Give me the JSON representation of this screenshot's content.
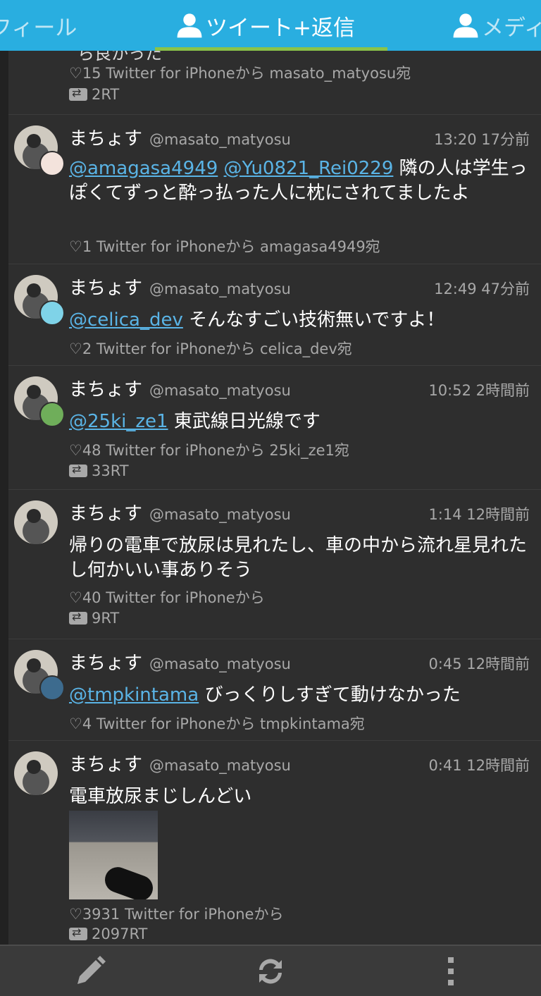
{
  "tabs": [
    {
      "label": "フィール",
      "icon": "user-icon"
    },
    {
      "label": "ツイート+返信",
      "icon": "user-icon",
      "active": true
    },
    {
      "label": "メディ",
      "icon": "user-icon"
    }
  ],
  "colors": {
    "accent": "#29aee0",
    "indicator": "#8bc34a",
    "mention": "#5ab4e6",
    "background": "#2e2e2e"
  },
  "partial_tweet": {
    "cut_text": "ら良かった",
    "meta": "♡15 Twitter for iPhoneから masato_matyosu宛",
    "rt": "2RT"
  },
  "tweets": [
    {
      "name": "まちょす",
      "handle": "@masato_matyosu",
      "time": "13:20 17分前",
      "mentions": [
        "@amagasa4949",
        "@Yu0821_Rei0229"
      ],
      "text": "隣の人は学生っぽくてずっと酔っ払った人に枕にされてましたよ",
      "meta": "♡1 Twitter for iPhoneから amagasa4949宛"
    },
    {
      "name": "まちょす",
      "handle": "@masato_matyosu",
      "time": "12:49 47分前",
      "mentions": [
        "@celica_dev"
      ],
      "text": "そんなすごい技術無いですよ！",
      "meta": "♡2 Twitter for iPhoneから celica_dev宛"
    },
    {
      "name": "まちょす",
      "handle": "@masato_matyosu",
      "time": "10:52 2時間前",
      "mentions": [
        "@25ki_ze1"
      ],
      "text": "東武線日光線です",
      "meta": "♡48 Twitter for iPhoneから 25ki_ze1宛",
      "rt": "33RT"
    },
    {
      "name": "まちょす",
      "handle": "@masato_matyosu",
      "time": "1:14 12時間前",
      "text": "帰りの電車で放尿は見れたし、車の中から流れ星見れたし何かいい事ありそう",
      "meta": "♡40 Twitter for iPhoneから",
      "rt": "9RT"
    },
    {
      "name": "まちょす",
      "handle": "@masato_matyosu",
      "time": "0:45 12時間前",
      "mentions": [
        "@tmpkintama"
      ],
      "text": "びっくりしすぎて動けなかった",
      "meta": "♡4 Twitter for iPhoneから tmpkintama宛"
    },
    {
      "name": "まちょす",
      "handle": "@masato_matyosu",
      "time": "0:41 12時間前",
      "text": "電車放尿まじしんどい",
      "meta": "♡3931 Twitter for iPhoneから",
      "rt": "2097RT"
    }
  ],
  "toolbar": {
    "icons": [
      "pencil-icon",
      "refresh-icon",
      "more-vertical-icon"
    ]
  }
}
